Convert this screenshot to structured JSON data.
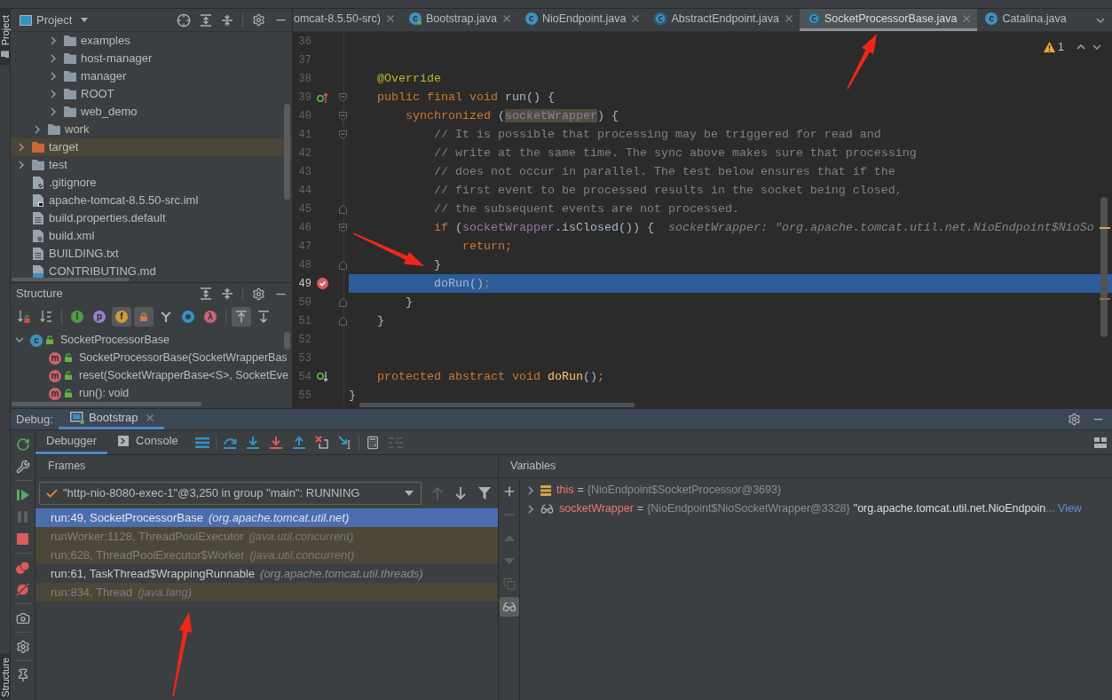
{
  "left_stripe": {
    "top_tab": {
      "label": "Project",
      "selected": true
    },
    "bottom_tab": {
      "label": "Structure",
      "selected": true
    }
  },
  "project_panel": {
    "title": "Project",
    "tree": [
      {
        "children": [
          {
            "children": [
              {
                "label": "examples",
                "kind": "folder",
                "expanded": false
              },
              {
                "label": "host-manager",
                "kind": "folder",
                "expanded": false
              },
              {
                "label": "manager",
                "kind": "folder",
                "expanded": false
              },
              {
                "label": "ROOT",
                "kind": "folder",
                "expanded": false
              },
              {
                "label": "web_demo",
                "kind": "folder",
                "expanded": false
              }
            ]
          },
          {
            "label": "work",
            "kind": "folder",
            "expanded": false
          }
        ]
      },
      {
        "label": "target",
        "kind": "excluded-folder",
        "expanded": false
      },
      {
        "label": "test",
        "kind": "folder",
        "expanded": false
      },
      {
        "label": ".gitignore",
        "kind": "ignore-file"
      },
      {
        "label": "apache-tomcat-8.5.50-src.iml",
        "kind": "module-file"
      },
      {
        "label": "build.properties.default",
        "kind": "text-file"
      },
      {
        "label": "build.xml",
        "kind": "ant-file"
      },
      {
        "label": "BUILDING.txt",
        "kind": "text-file"
      },
      {
        "label": "CONTRIBUTING.md",
        "kind": "markdown-file"
      }
    ]
  },
  "structure_panel": {
    "title": "Structure",
    "toolbar": [
      [
        {
          "kind": "sort-visibility",
          "selected": false
        },
        {
          "kind": "sort-alpha",
          "selected": false
        }
      ],
      [
        {
          "kind": "inherited",
          "glyph": "I",
          "selected": false
        },
        {
          "kind": "properties",
          "glyph": "p",
          "selected": false
        },
        {
          "kind": "fields",
          "glyph": "f",
          "selected": true
        },
        {
          "kind": "non-public",
          "selected": true
        },
        {
          "kind": "hierarchy",
          "selected": false
        },
        {
          "kind": "anonymous",
          "selected": false
        },
        {
          "kind": "lambdas",
          "glyph": "λ",
          "selected": false
        }
      ],
      [
        {
          "kind": "autoscroll-to-source",
          "selected": true
        },
        {
          "kind": "autoscroll-from-source",
          "selected": false
        }
      ]
    ],
    "tree": [
      {
        "label": "SocketProcessorBase",
        "kind": "class",
        "glyph": "c",
        "expanded": true,
        "children": [
          {
            "label": "SocketProcessorBase(SocketWrapperBas",
            "kind": "method",
            "glyph": "m"
          },
          {
            "label": "reset(SocketWrapperBase<S>, SocketEve",
            "kind": "method",
            "glyph": "m"
          },
          {
            "label": "run(): void",
            "kind": "method",
            "glyph": "m"
          }
        ]
      }
    ]
  },
  "editor": {
    "tabs": [
      {
        "label": "omcat-8.5.50-src)",
        "kind": "clipped-start",
        "selected": false
      },
      {
        "label": "Bootstrap.java",
        "kind": "whole",
        "icon": {
          "kind": "runnable-class",
          "glyph": "c"
        },
        "selected": false
      },
      {
        "label": "NioEndpoint.java",
        "kind": "whole",
        "icon": {
          "kind": "class",
          "glyph": "c"
        },
        "selected": false
      },
      {
        "label": "AbstractEndpoint.java",
        "kind": "whole",
        "icon": {
          "kind": "abstract-class",
          "glyph": "c"
        },
        "selected": false
      },
      {
        "label": "SocketProcessorBase.java",
        "kind": "whole",
        "icon": {
          "kind": "abstract-class",
          "glyph": "c"
        },
        "selected": true
      },
      {
        "label": "Catalina.java",
        "kind": "clipped-end",
        "icon": {
          "kind": "class",
          "glyph": "c"
        },
        "selected": false
      }
    ],
    "warning_count": "1",
    "lines": [
      {
        "number": "36",
        "current": false
      },
      {
        "number": "37",
        "current": false
      },
      {
        "number": "38",
        "current": false,
        "tokens": [
          {
            "kind": "annotation",
            "text": "    @Override"
          }
        ]
      },
      {
        "number": "39",
        "current": false,
        "gutter_icon": {
          "kind": "override"
        },
        "fold": {
          "kind": "start"
        },
        "tokens": [
          {
            "kind": "keyword",
            "text": "    public final void "
          },
          {
            "kind": "plain",
            "text": "run() {"
          }
        ]
      },
      {
        "number": "40",
        "current": false,
        "fold": {
          "kind": "start"
        },
        "tokens": [
          {
            "kind": "keyword",
            "text": "        synchronized "
          },
          {
            "kind": "plain",
            "text": "("
          },
          {
            "kind": "field-usage",
            "text": "socketWrapper"
          },
          {
            "kind": "plain",
            "text": ") {"
          }
        ]
      },
      {
        "number": "41",
        "current": false,
        "fold": {
          "kind": "start"
        },
        "tokens": [
          {
            "kind": "comment",
            "text": "            // It is possible that processing may be triggered for read and"
          }
        ]
      },
      {
        "number": "42",
        "current": false,
        "tokens": [
          {
            "kind": "comment",
            "text": "            // write at the same time. The sync above makes sure that processing"
          }
        ]
      },
      {
        "number": "43",
        "current": false,
        "tokens": [
          {
            "kind": "comment",
            "text": "            // does not occur in parallel. The test below ensures that if the"
          }
        ]
      },
      {
        "number": "44",
        "current": false,
        "tokens": [
          {
            "kind": "comment",
            "text": "            // first event to be processed results in the socket being closed,"
          }
        ]
      },
      {
        "number": "45",
        "current": false,
        "fold": {
          "kind": "end"
        },
        "tokens": [
          {
            "kind": "comment",
            "text": "            // the subsequent events are not processed."
          }
        ]
      },
      {
        "number": "46",
        "current": false,
        "fold": {
          "kind": "start"
        },
        "tokens": [
          {
            "kind": "keyword",
            "text": "            if "
          },
          {
            "kind": "plain",
            "text": "("
          },
          {
            "kind": "field",
            "text": "socketWrapper"
          },
          {
            "kind": "plain",
            "text": ".isClosed()) {"
          }
        ],
        "hint": "socketWrapper: \"org.apache.tomcat.util.net.NioEndpoint$NioSo"
      },
      {
        "number": "47",
        "current": false,
        "tokens": [
          {
            "kind": "keyword",
            "text": "                return;"
          }
        ]
      },
      {
        "number": "48",
        "current": false,
        "fold": {
          "kind": "end"
        },
        "tokens": [
          {
            "kind": "plain",
            "text": "            }"
          }
        ]
      },
      {
        "number": "49",
        "current": true,
        "gutter_icon": {
          "kind": "breakpoint"
        },
        "tokens": [
          {
            "kind": "plain",
            "text": "            doRun()"
          },
          {
            "kind": "keyword",
            "text": ";"
          }
        ]
      },
      {
        "number": "50",
        "current": false,
        "fold": {
          "kind": "end"
        },
        "tokens": [
          {
            "kind": "plain",
            "text": "        }"
          }
        ]
      },
      {
        "number": "51",
        "current": false,
        "fold": {
          "kind": "end"
        },
        "tokens": [
          {
            "kind": "plain",
            "text": "    }"
          }
        ]
      },
      {
        "number": "52",
        "current": false
      },
      {
        "number": "53",
        "current": false
      },
      {
        "number": "54",
        "current": false,
        "gutter_icon": {
          "kind": "implemented"
        },
        "tokens": [
          {
            "kind": "keyword",
            "text": "    protected abstract void "
          },
          {
            "kind": "method",
            "text": "doRun"
          },
          {
            "kind": "plain",
            "text": "()"
          },
          {
            "kind": "keyword",
            "text": ";"
          }
        ]
      },
      {
        "number": "55",
        "current": false,
        "tokens": [
          {
            "kind": "plain",
            "text": "}"
          }
        ]
      }
    ]
  },
  "debug": {
    "title": "Debug:",
    "session_tab": {
      "label": "Bootstrap",
      "selected": true
    },
    "side_toolbar": [
      [
        {
          "kind": "rerun",
          "disabled": false
        },
        {
          "kind": "wrench",
          "disabled": false
        }
      ],
      [
        {
          "kind": "resume",
          "disabled": false
        },
        {
          "kind": "pause",
          "disabled": true
        },
        {
          "kind": "stop",
          "disabled": false
        }
      ],
      [
        {
          "kind": "view-breakpoints",
          "disabled": false
        },
        {
          "kind": "mute-breakpoints",
          "disabled": false
        }
      ],
      [
        {
          "kind": "snapshot",
          "disabled": false
        }
      ],
      [
        {
          "kind": "settings",
          "disabled": false
        }
      ],
      [
        {
          "kind": "pin",
          "disabled": false
        }
      ]
    ],
    "tabs": [
      {
        "label": "Debugger",
        "kind": "debugger",
        "selected": true
      },
      {
        "label": "Console",
        "kind": "console",
        "selected": false
      }
    ],
    "toolbar": [
      [
        {
          "kind": "show-execution-point",
          "disabled": false
        }
      ],
      [
        {
          "kind": "step-over",
          "disabled": false
        },
        {
          "kind": "step-into",
          "disabled": false
        },
        {
          "kind": "force-step-into",
          "disabled": false
        },
        {
          "kind": "step-out",
          "disabled": false
        },
        {
          "kind": "drop-frame",
          "disabled": false
        },
        {
          "kind": "run-to-cursor",
          "disabled": false
        }
      ],
      [
        {
          "kind": "evaluate",
          "disabled": false
        },
        {
          "kind": "trace",
          "disabled": true
        }
      ]
    ],
    "frames": {
      "title": "Frames",
      "thread": "\"http-nio-8080-exec-1\"@3,250 in group \"main\": RUNNING",
      "toolbar": [
        {
          "kind": "previous-frame",
          "disabled": true
        },
        {
          "kind": "next-frame",
          "disabled": false
        },
        {
          "kind": "filter",
          "disabled": false
        }
      ],
      "items": [
        {
          "method": "run:49, SocketProcessorBase",
          "package": "(org.apache.tomcat.util.net)",
          "selected": true,
          "library": false
        },
        {
          "method": "runWorker:1128, ThreadPoolExecutor",
          "package": "(java.util.concurrent)",
          "selected": false,
          "library": true
        },
        {
          "method": "run:628, ThreadPoolExecutor$Worker",
          "package": "(java.util.concurrent)",
          "selected": false,
          "library": true
        },
        {
          "method": "run:61, TaskThread$WrappingRunnable",
          "package": "(org.apache.tomcat.util.threads)",
          "selected": false,
          "library": false
        },
        {
          "method": "run:834, Thread",
          "package": "(java.lang)",
          "selected": false,
          "library": true
        }
      ]
    },
    "variables": {
      "title": "Variables",
      "toolbar": [
        {
          "kind": "add",
          "disabled": false,
          "selected": false
        },
        {
          "kind": "remove",
          "disabled": true,
          "selected": false
        },
        {
          "kind": "move-up",
          "disabled": true,
          "selected": false
        },
        {
          "kind": "move-down",
          "disabled": true,
          "selected": false
        },
        {
          "kind": "duplicate",
          "disabled": true,
          "selected": false
        },
        {
          "kind": "inline-watches",
          "disabled": false,
          "selected": true
        }
      ],
      "items": [
        {
          "kind": "object",
          "name": "this",
          "operator": "=",
          "value": "{NioEndpoint$SocketProcessor@3693}",
          "expanded": false
        },
        {
          "kind": "watch",
          "name": "socketWrapper",
          "operator": "=",
          "value": "{NioEndpoint$NioSocketWrapper@3328}",
          "string": "\"org.apache.tomcat.util.net.NioEndpoin",
          "link": "... View",
          "expanded": false
        }
      ]
    }
  },
  "annotations": [
    {
      "kind": "arrow"
    },
    {
      "kind": "arrow"
    },
    {
      "kind": "arrow"
    }
  ]
}
